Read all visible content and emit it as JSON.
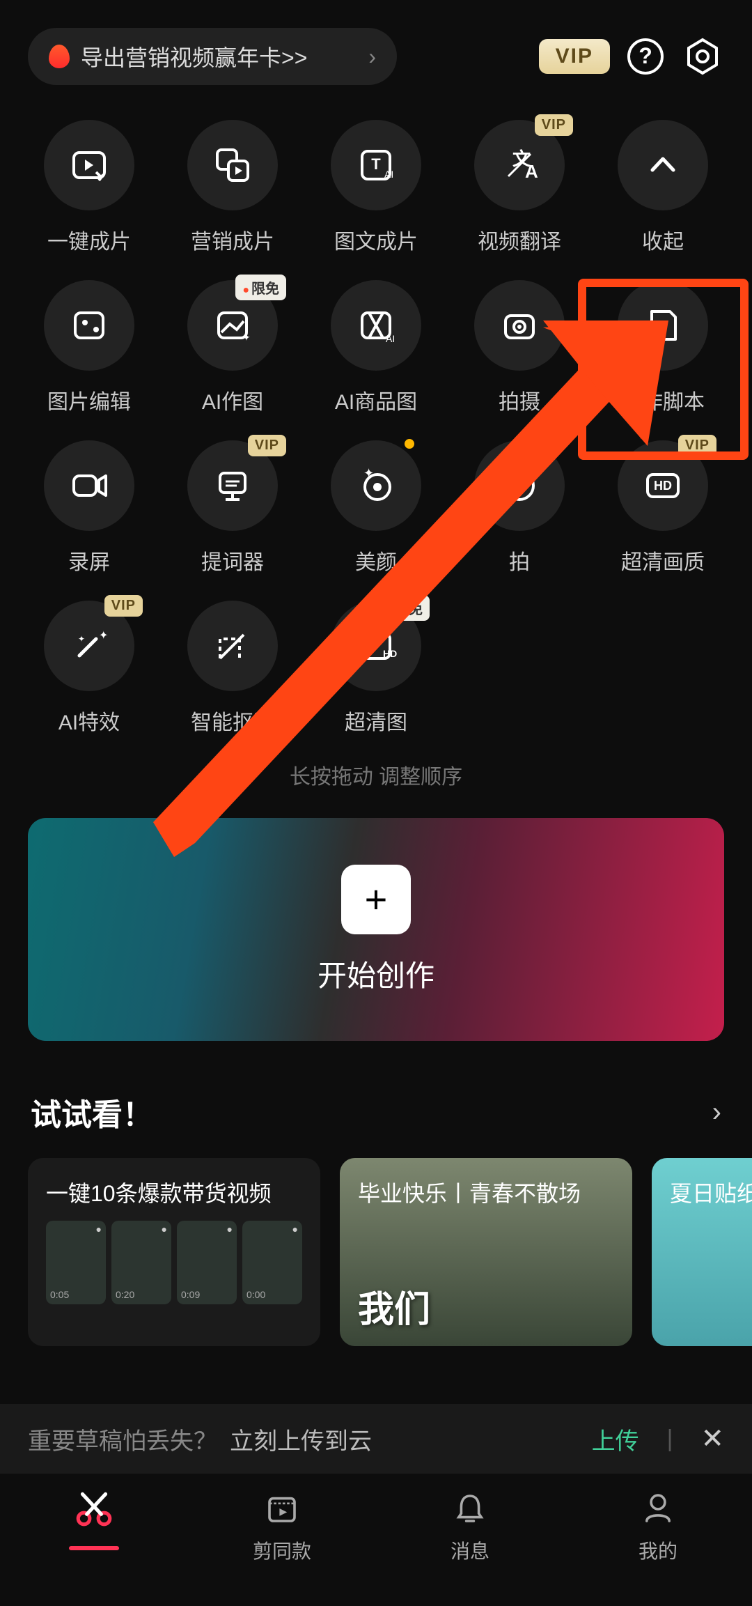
{
  "header": {
    "promo_text": "导出营销视频赢年卡>>",
    "vip_label": "VIP"
  },
  "tools": [
    {
      "label": "一键成片",
      "tag": null
    },
    {
      "label": "营销成片",
      "tag": null
    },
    {
      "label": "图文成片",
      "tag": null
    },
    {
      "label": "视频翻译",
      "tag": "vip"
    },
    {
      "label": "收起",
      "tag": null
    },
    {
      "label": "图片编辑",
      "tag": null
    },
    {
      "label": "AI作图",
      "tag": "free"
    },
    {
      "label": "AI商品图",
      "tag": null
    },
    {
      "label": "拍摄",
      "tag": null
    },
    {
      "label": "创作脚本",
      "tag": null
    },
    {
      "label": "录屏",
      "tag": null
    },
    {
      "label": "提词器",
      "tag": "vip"
    },
    {
      "label": "美颜",
      "tag": null,
      "dot": true
    },
    {
      "label": "拍",
      "tag": null
    },
    {
      "label": "超清画质",
      "tag": "vip"
    },
    {
      "label": "AI特效",
      "tag": "vip"
    },
    {
      "label": "智能抠图",
      "tag": null
    },
    {
      "label": "超清图",
      "tag": "free"
    }
  ],
  "tags": {
    "vip": "VIP",
    "free": "限免"
  },
  "hint_text": "长按拖动  调整顺序",
  "create": {
    "title": "开始创作"
  },
  "try": {
    "heading": "试试看！",
    "cards": [
      {
        "title": "一键10条爆款带货视频",
        "thumb_times": [
          "0:05",
          "0:20",
          "0:09",
          "0:00"
        ]
      },
      {
        "title": "毕业快乐丨青春不散场",
        "big": "我们"
      },
      {
        "title": "夏日贴纸"
      }
    ]
  },
  "upload": {
    "question": "重要草稿怕丢失？",
    "prompt": "立刻上传到云",
    "action": "上传"
  },
  "nav": [
    {
      "label": ""
    },
    {
      "label": "剪同款"
    },
    {
      "label": "消息"
    },
    {
      "label": "我的"
    }
  ]
}
